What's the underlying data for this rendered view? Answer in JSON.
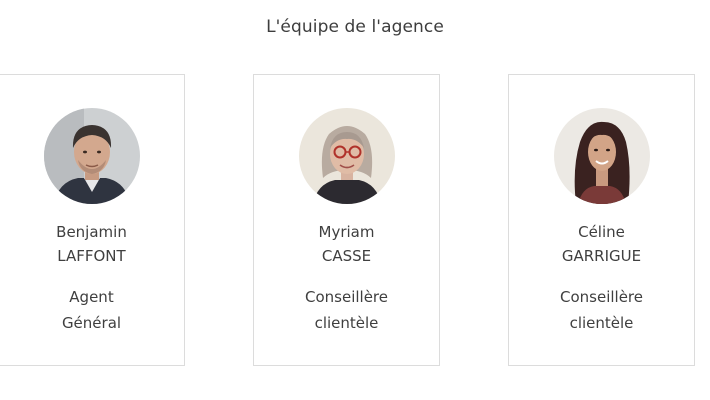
{
  "section": {
    "title": "L'équipe de l'agence"
  },
  "team": [
    {
      "first_name": "Benjamin",
      "last_name": "LAFFONT",
      "role_line1": "Agent",
      "role_line2": "Général",
      "photo_icon": "portrait-photo"
    },
    {
      "first_name": "Myriam",
      "last_name": "CASSE",
      "role_line1": "Conseillère",
      "role_line2": "clientèle",
      "photo_icon": "portrait-photo"
    },
    {
      "first_name": "Céline",
      "last_name": "GARRIGUE",
      "role_line1": "Conseillère",
      "role_line2": "clientèle",
      "photo_icon": "portrait-photo"
    }
  ],
  "colors": {
    "text": "#3f3f3f",
    "card_border": "#dcdcdc",
    "background": "#ffffff"
  }
}
